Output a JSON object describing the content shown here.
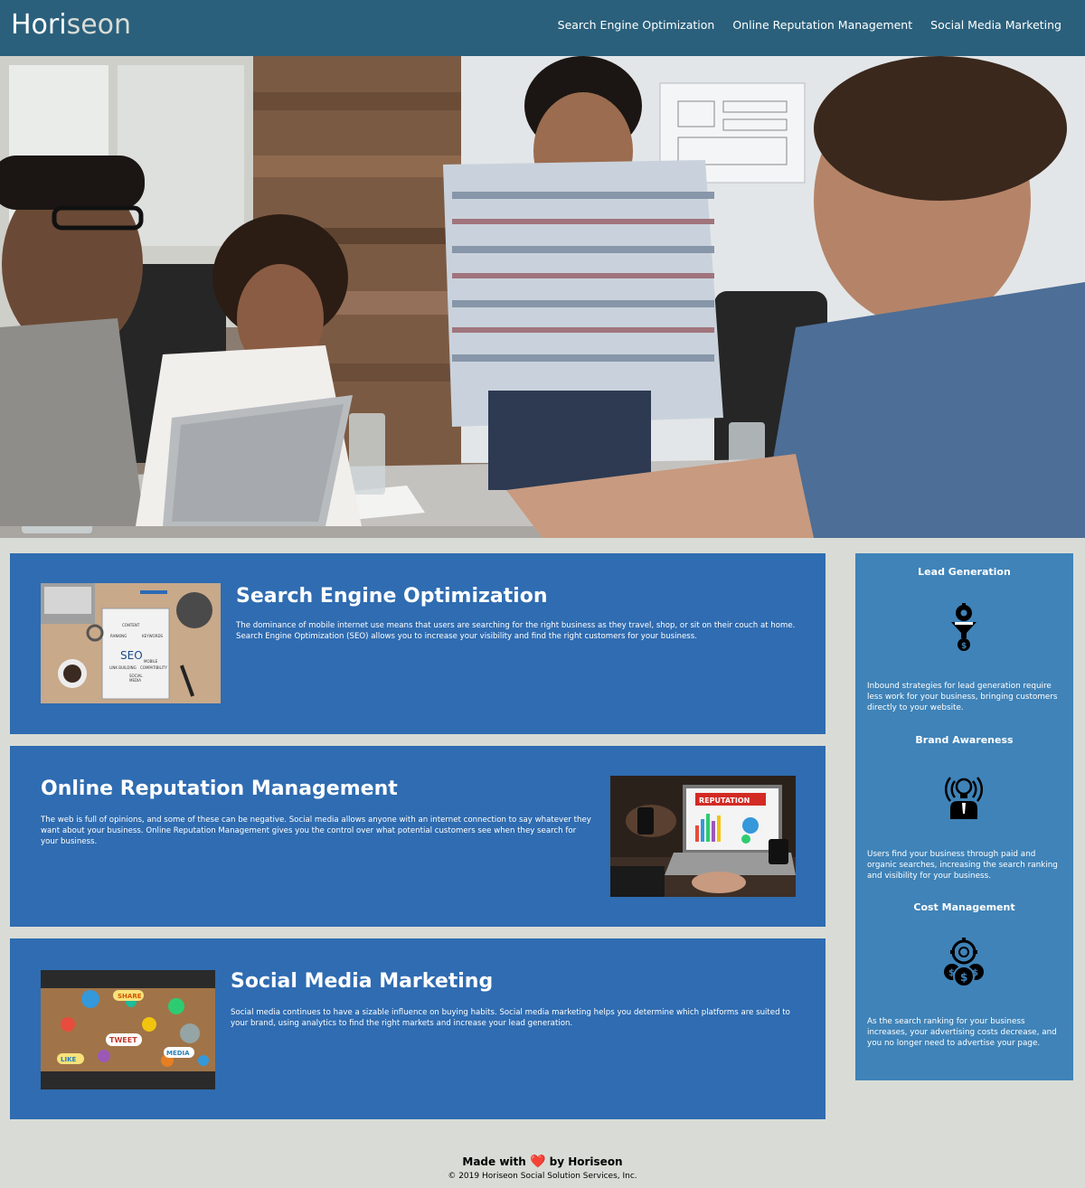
{
  "header": {
    "logo_main": "Hori",
    "logo_accent": "seon",
    "nav": [
      {
        "label": "Search Engine Optimization"
      },
      {
        "label": "Online Reputation Management"
      },
      {
        "label": "Social Media Marketing"
      }
    ]
  },
  "content": [
    {
      "title": "Search Engine Optimization",
      "body": "The dominance of mobile internet use means that users are searching for the right business as they travel, shop, or sit on their couch at home. Search Engine Optimization (SEO) allows you to increase your visibility and find the right customers for your business.",
      "image_text": {
        "seo": "SEO",
        "words": [
          "CONTENT",
          "RANKING",
          "KEYWORDS",
          "LINK BUILDING",
          "MOBILE",
          "COMPATIBILITY",
          "SOCIAL",
          "MEDIA"
        ]
      }
    },
    {
      "title": "Online Reputation Management",
      "body": "The web is full of opinions, and some of these can be negative. Social media allows anyone with an internet connection to say whatever they want about your business. Online Reputation Management gives you the control over what potential customers see when they search for your business.",
      "image_text": {
        "banner": "REPUTATION"
      }
    },
    {
      "title": "Social Media Marketing",
      "body": "Social media continues to have a sizable influence on buying habits. Social media marketing helps you determine which platforms are suited to your brand, using analytics to find the right markets and increase your lead generation.",
      "image_text": {
        "bubbles": [
          "SHARE",
          "TWEET",
          "LIKE",
          "MEDIA"
        ]
      }
    }
  ],
  "benefits": [
    {
      "title": "Lead Generation",
      "icon": "lead-funnel-icon",
      "body": "Inbound strategies for lead generation require less work for your business, bringing customers directly to your website."
    },
    {
      "title": "Brand Awareness",
      "icon": "bulb-broadcast-icon",
      "body": "Users find your business through paid and organic searches, increasing the search ranking and visibility for your business."
    },
    {
      "title": "Cost Management",
      "icon": "coins-gear-icon",
      "body": "As the search ranking for your business increases, your advertising costs decrease, and you no longer need to advertise your page."
    }
  ],
  "footer": {
    "made_with": "Made with",
    "heart": "❤️",
    "by": "by Horiseon",
    "copyright": "© 2019 Horiseon Social Solution Services, Inc."
  }
}
